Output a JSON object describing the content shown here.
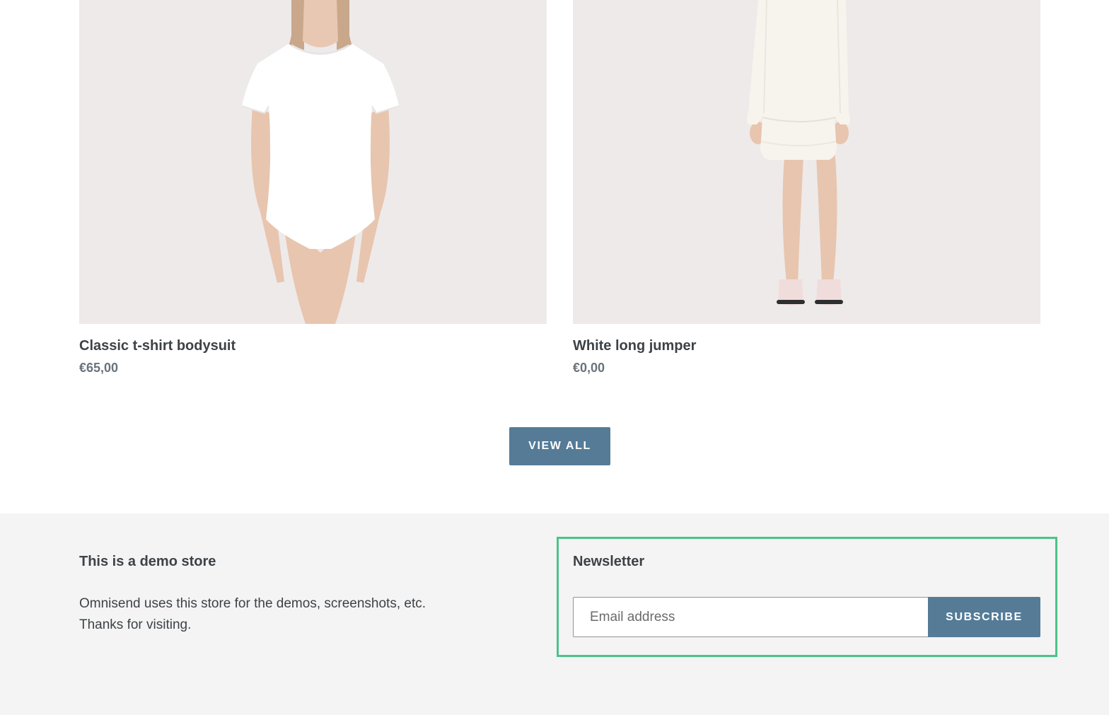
{
  "products": [
    {
      "title": "Classic t-shirt bodysuit",
      "price": "€65,00",
      "image": "model-white-tshirt-bodysuit"
    },
    {
      "title": "White long jumper",
      "price": "€0,00",
      "image": "model-white-long-jumper"
    }
  ],
  "view_all_label": "VIEW ALL",
  "footer": {
    "about_title": "This is a demo store",
    "about_line1": "Omnisend uses this store for the demos, screenshots, etc.",
    "about_line2": "Thanks for visiting.",
    "newsletter_title": "Newsletter",
    "email_placeholder": "Email address",
    "subscribe_label": "SUBSCRIBE"
  },
  "colors": {
    "accent": "#557b97",
    "highlight_border": "#4cc38a",
    "footer_bg": "#f4f4f4",
    "image_bg": "#eeeaea"
  }
}
